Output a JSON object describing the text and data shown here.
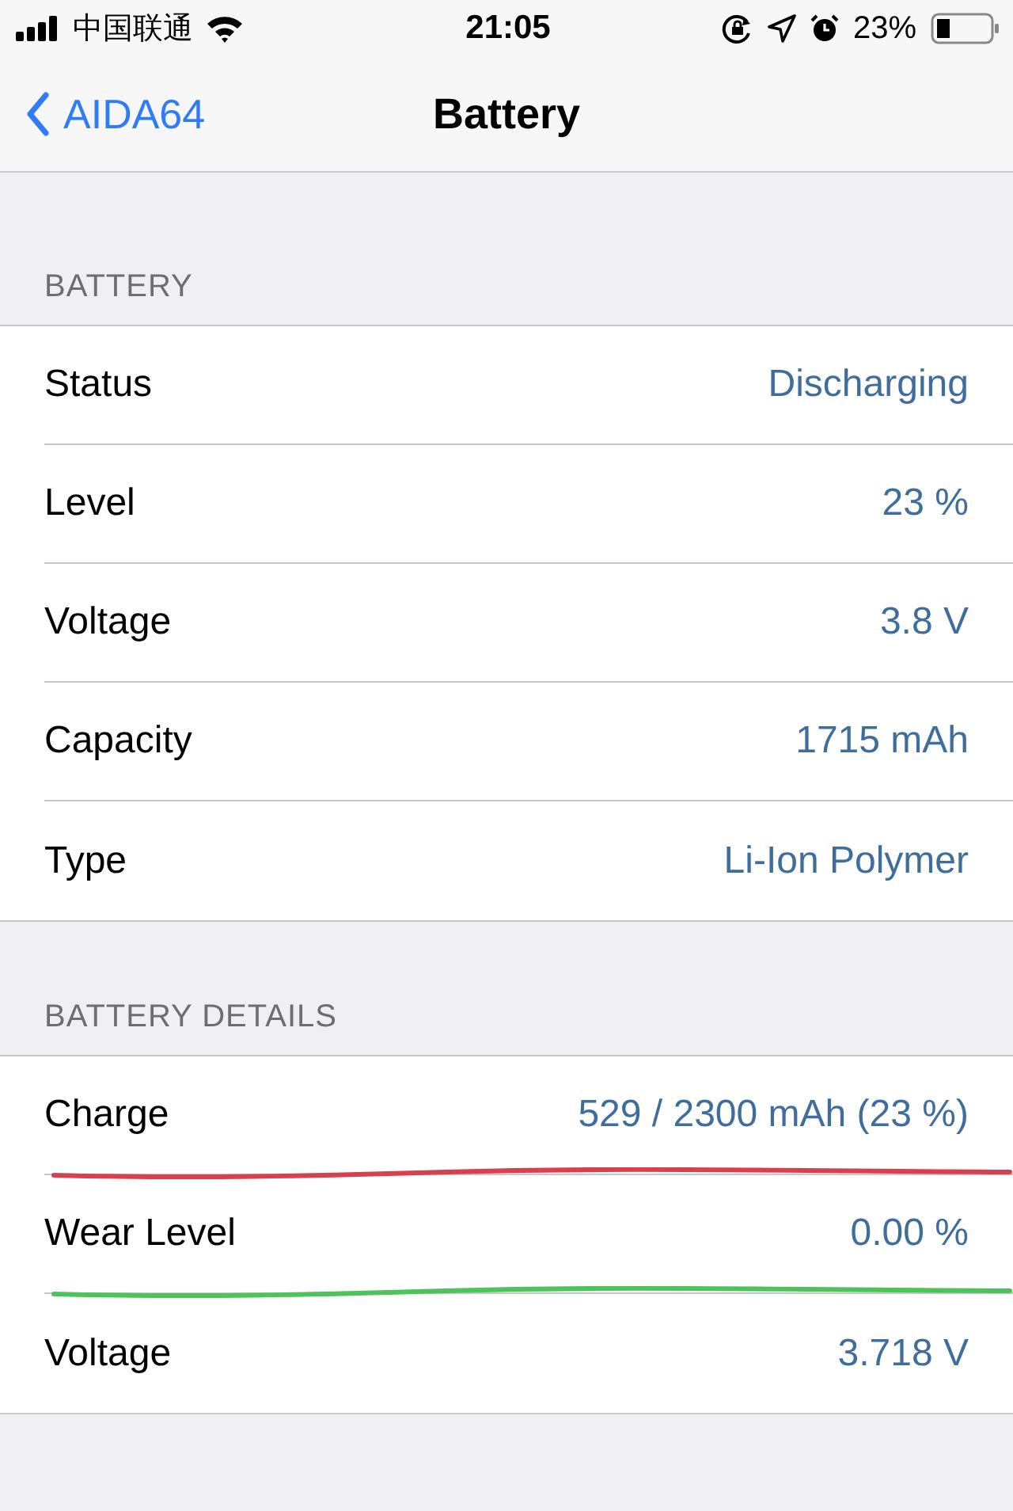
{
  "status_bar": {
    "carrier": "中国联通",
    "time": "21:05",
    "battery": "23%"
  },
  "nav": {
    "back": "AIDA64",
    "title": "Battery"
  },
  "sections": [
    {
      "header": "BATTERY",
      "rows": [
        {
          "label": "Status",
          "value": "Discharging"
        },
        {
          "label": "Level",
          "value": "23 %"
        },
        {
          "label": "Voltage",
          "value": "3.8 V"
        },
        {
          "label": "Capacity",
          "value": "1715 mAh"
        },
        {
          "label": "Type",
          "value": "Li-Ion Polymer"
        }
      ]
    },
    {
      "header": "BATTERY DETAILS",
      "rows": [
        {
          "label": "Charge",
          "value": "529 / 2300 mAh (23 %)",
          "color": "#d9404f"
        },
        {
          "label": "Wear Level",
          "value": "0.00 %",
          "color": "#4cc45a"
        },
        {
          "label": "Voltage",
          "value": "3.718 V"
        }
      ]
    }
  ]
}
